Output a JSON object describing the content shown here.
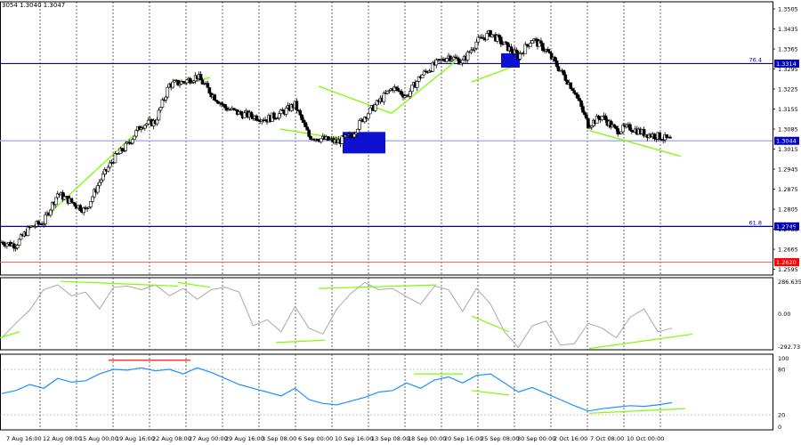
{
  "header": {
    "ohlc_text": "3054 1.3040 1.3047"
  },
  "colors": {
    "background": "#ffffff",
    "candle": "#000000",
    "grid": "#000000",
    "fib_line": "#0000b0",
    "current_line": "#a9a9f0",
    "support_line": "#ff6060",
    "trendline": "#7cfc00",
    "zone": "#1010d0",
    "cci_line": "#a8a8a8",
    "rsi_line": "#1e90ff",
    "rsi_marker": "#ff3b3b",
    "price_tag_bg": "#0000c0",
    "support_tag_bg": "#ff0000"
  },
  "levels": [
    {
      "name": "fib-76",
      "label": "76.4",
      "price": 1.3314,
      "tag": "1.3314",
      "kind": "fib"
    },
    {
      "name": "current",
      "label": "",
      "price": 1.3044,
      "tag": "1.3044",
      "kind": "current"
    },
    {
      "name": "fib-61",
      "label": "61.8",
      "price": 1.2745,
      "tag": "1.2745",
      "kind": "fib"
    },
    {
      "name": "support",
      "label": "",
      "price": 1.262,
      "tag": "1.2620",
      "kind": "support"
    }
  ],
  "chart_data": [
    {
      "type": "candlestick",
      "title": "",
      "yticks": [
        "1.3505",
        "1.3435",
        "1.3365",
        "1.3295",
        "1.3225",
        "1.3155",
        "1.3085",
        "1.3015",
        "1.2945",
        "1.2875",
        "1.2805",
        "1.2735",
        "1.2665",
        "1.2595"
      ],
      "ylim": [
        1.2575,
        1.353
      ],
      "grid": true,
      "x": [
        "7 Aug 16:00",
        "12 Aug 08:00",
        "15 Aug 00:00",
        "19 Aug 16:00",
        "22 Aug 08:00",
        "27 Aug 00:00",
        "29 Aug 16:00",
        "3 Sep 08:00",
        "6 Sep 00:00",
        "10 Sep 16:00",
        "13 Sep 08:00",
        "18 Sep 00:00",
        "20 Sep 16:00",
        "25 Sep 08:00",
        "30 Sep 00:00",
        "2 Oct 16:00",
        "7 Oct 08:00",
        "10 Oct 00:00"
      ],
      "close_path": [
        1.269,
        1.268,
        1.274,
        1.276,
        1.286,
        1.283,
        1.28,
        1.29,
        1.298,
        1.303,
        1.31,
        1.311,
        1.324,
        1.325,
        1.327,
        1.321,
        1.316,
        1.314,
        1.313,
        1.312,
        1.314,
        1.317,
        1.306,
        1.305,
        1.304,
        1.306,
        1.313,
        1.318,
        1.323,
        1.32,
        1.327,
        1.331,
        1.334,
        1.332,
        1.339,
        1.342,
        1.338,
        1.334,
        1.34,
        1.336,
        1.329,
        1.322,
        1.31,
        1.313,
        1.308,
        1.309,
        1.307,
        1.306,
        1.3044
      ]
    },
    {
      "type": "line",
      "title": "",
      "yticks": [
        "286.6354",
        "0.00",
        "-292.7316"
      ],
      "ylim": [
        -300,
        300
      ],
      "values": [
        -200,
        -80,
        30,
        200,
        240,
        150,
        180,
        40,
        220,
        230,
        200,
        240,
        150,
        210,
        120,
        200,
        220,
        180,
        -100,
        -50,
        -150,
        60,
        -120,
        -170,
        40,
        170,
        260,
        200,
        210,
        140,
        80,
        230,
        200,
        20,
        210,
        80,
        -150,
        -280,
        -100,
        -60,
        -260,
        -250,
        -80,
        -120,
        -200,
        -30,
        40,
        -150,
        -120
      ]
    },
    {
      "type": "line",
      "title": "",
      "yticks": [
        "100",
        "80",
        "20",
        "0"
      ],
      "ylim": [
        0,
        100
      ],
      "values": [
        48,
        52,
        60,
        55,
        68,
        63,
        65,
        74,
        80,
        79,
        82,
        78,
        80,
        74,
        82,
        76,
        68,
        60,
        55,
        50,
        45,
        55,
        40,
        35,
        33,
        38,
        43,
        50,
        52,
        62,
        55,
        66,
        70,
        62,
        72,
        74,
        62,
        50,
        56,
        48,
        40,
        32,
        25,
        28,
        30,
        32,
        31,
        33,
        36
      ]
    }
  ]
}
